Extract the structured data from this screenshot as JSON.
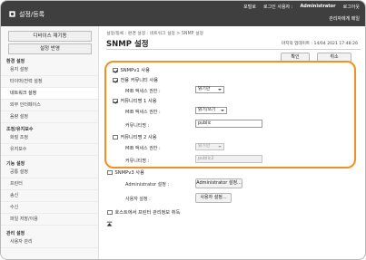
{
  "app": {
    "title": "설정/등록"
  },
  "toplinks": {
    "portal": "포털로",
    "login_user_label": "로그인 사용자 :",
    "user": "Administrator",
    "logout": "로그아웃",
    "admin_mail": "관리자에게 메일"
  },
  "sidebar": {
    "device_restart": "디바이스 재기동",
    "apply_settings": "설정 반영",
    "section_env": "환경 설정",
    "env_items": [
      "용지 설정",
      "타이머/전력 설정",
      "네트워크 설정",
      "외부 인터페이스",
      "음량 설정"
    ],
    "section_adjust": "조정/유지보수",
    "adjust_items": [
      "화질 조정",
      "유지보수"
    ],
    "section_func": "기능 설정",
    "func_items": [
      "공통 설정",
      "프린터",
      "송신",
      "수신",
      "파일 저장/이용"
    ],
    "section_mgmt": "관리 설정",
    "mgmt_items": [
      "사용자 관리"
    ]
  },
  "main": {
    "breadcrumb": "설정/등록 : 환경 설정 : 네트워크 설정 > SNMP 설정",
    "title": "SNMP 설정",
    "last_update": "마지막 업데이트 : 14/04 2021 17:48:26",
    "ok": "확인",
    "cancel": "취소"
  },
  "snmp": {
    "v1_use": "SNMPv1 사용",
    "dedicated_community": "전용 커뮤니티 사용",
    "mib_access": "MIB 액세스 권한 :",
    "mib_access_value_1": "읽기만",
    "community1_use": "커뮤니티명 1 사용",
    "mib_access_value_2": "읽기/쓰기",
    "community_name": "커뮤니티명 :",
    "community1_value": "public",
    "community2_use": "커뮤니티명 2 사용",
    "mib_access_value_3": "읽기만",
    "community2_value": "public2",
    "v3_use": "SNMPv3 사용",
    "admin_settings_label": "Administrator 설정 :",
    "admin_settings_button": "Administrator 설정...",
    "user_settings_label": "사용자 설정 :",
    "user_settings_button": "사용자 설정...",
    "host_resource": "호스트에서 프린터 관리정보 취득"
  }
}
